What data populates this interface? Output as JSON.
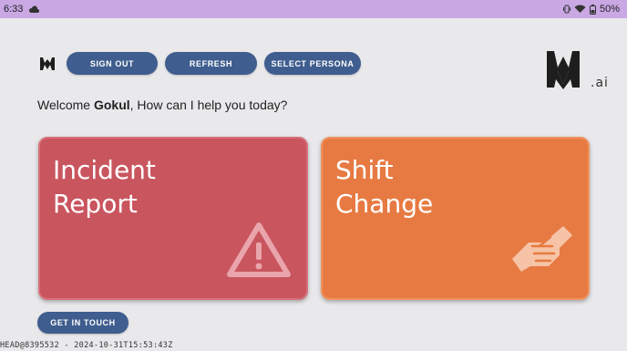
{
  "status_bar": {
    "time": "6:33",
    "battery": "50%",
    "icons": [
      "cloud-icon",
      "vibrate-icon",
      "wifi-icon",
      "battery-icon"
    ]
  },
  "toolbar": {
    "logo_icon": "app-logo-icon",
    "sign_out_label": "SIGN OUT",
    "refresh_label": "REFRESH",
    "select_persona_label": "SELECT PERSONA"
  },
  "brand": {
    "suffix": ".ai",
    "logo_icon": "brand-logo-icon"
  },
  "welcome": {
    "prefix": "Welcome ",
    "name": "Gokul",
    "suffix": ", How can I help you today?"
  },
  "cards": [
    {
      "title_line1": "Incident",
      "title_line2": "Report",
      "icon": "warning-icon",
      "color": "#c9555f"
    },
    {
      "title_line1": "Shift",
      "title_line2": "Change",
      "icon": "handshake-icon",
      "color": "#e77a42"
    }
  ],
  "footer": {
    "get_in_touch_label": "GET IN TOUCH",
    "build_info": "HEAD@8395532 - 2024-10-31T15:53:43Z"
  },
  "colors": {
    "button": "#3f5d8e",
    "status_bar": "#c9a8e4",
    "background": "#e9e9ec"
  }
}
